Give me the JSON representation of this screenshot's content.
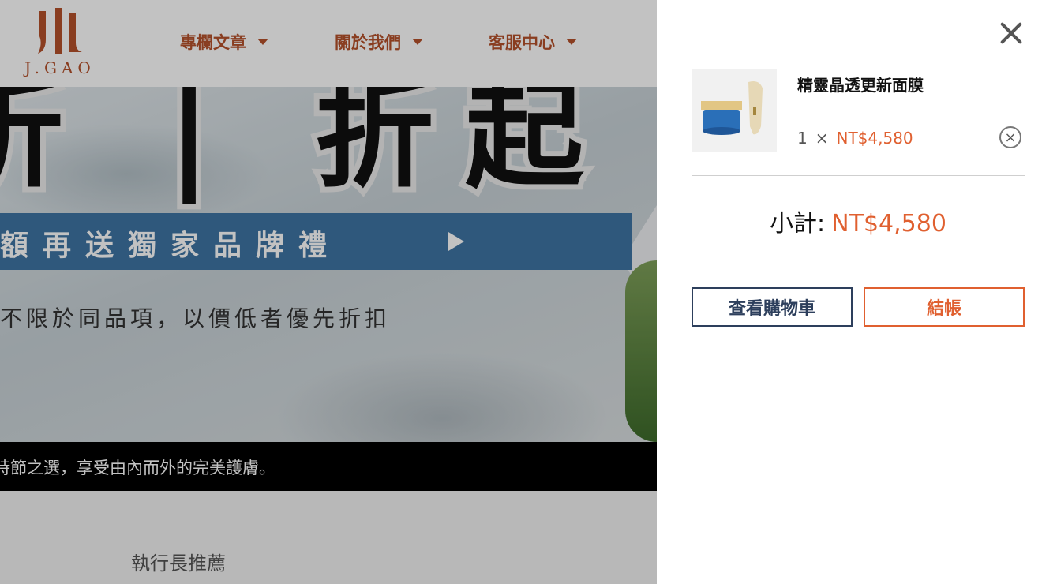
{
  "header": {
    "logo_text": "J.GAO",
    "nav": [
      {
        "label": "專欄文章"
      },
      {
        "label": "關於我們"
      },
      {
        "label": "客服中心"
      }
    ]
  },
  "hero": {
    "big_chars": "折 | 折起",
    "banner_text": "額再送獨家品牌禮",
    "note": "不限於同品項，以價低者優先折扣",
    "caption": "時節之選，享受由內而外的完美護膚。"
  },
  "section_label": "執行長推薦",
  "cart": {
    "item": {
      "name": "精靈晶透更新面膜",
      "quantity": "1",
      "times": "×",
      "price": "NT$4,580"
    },
    "subtotal_label": "小計:",
    "subtotal_value": "NT$4,580",
    "view_cart_label": "查看購物車",
    "checkout_label": "結帳"
  },
  "colors": {
    "brand": "#b5512b",
    "price": "#e06030",
    "navy": "#2d3f5c",
    "banner": "#3e74a3"
  }
}
